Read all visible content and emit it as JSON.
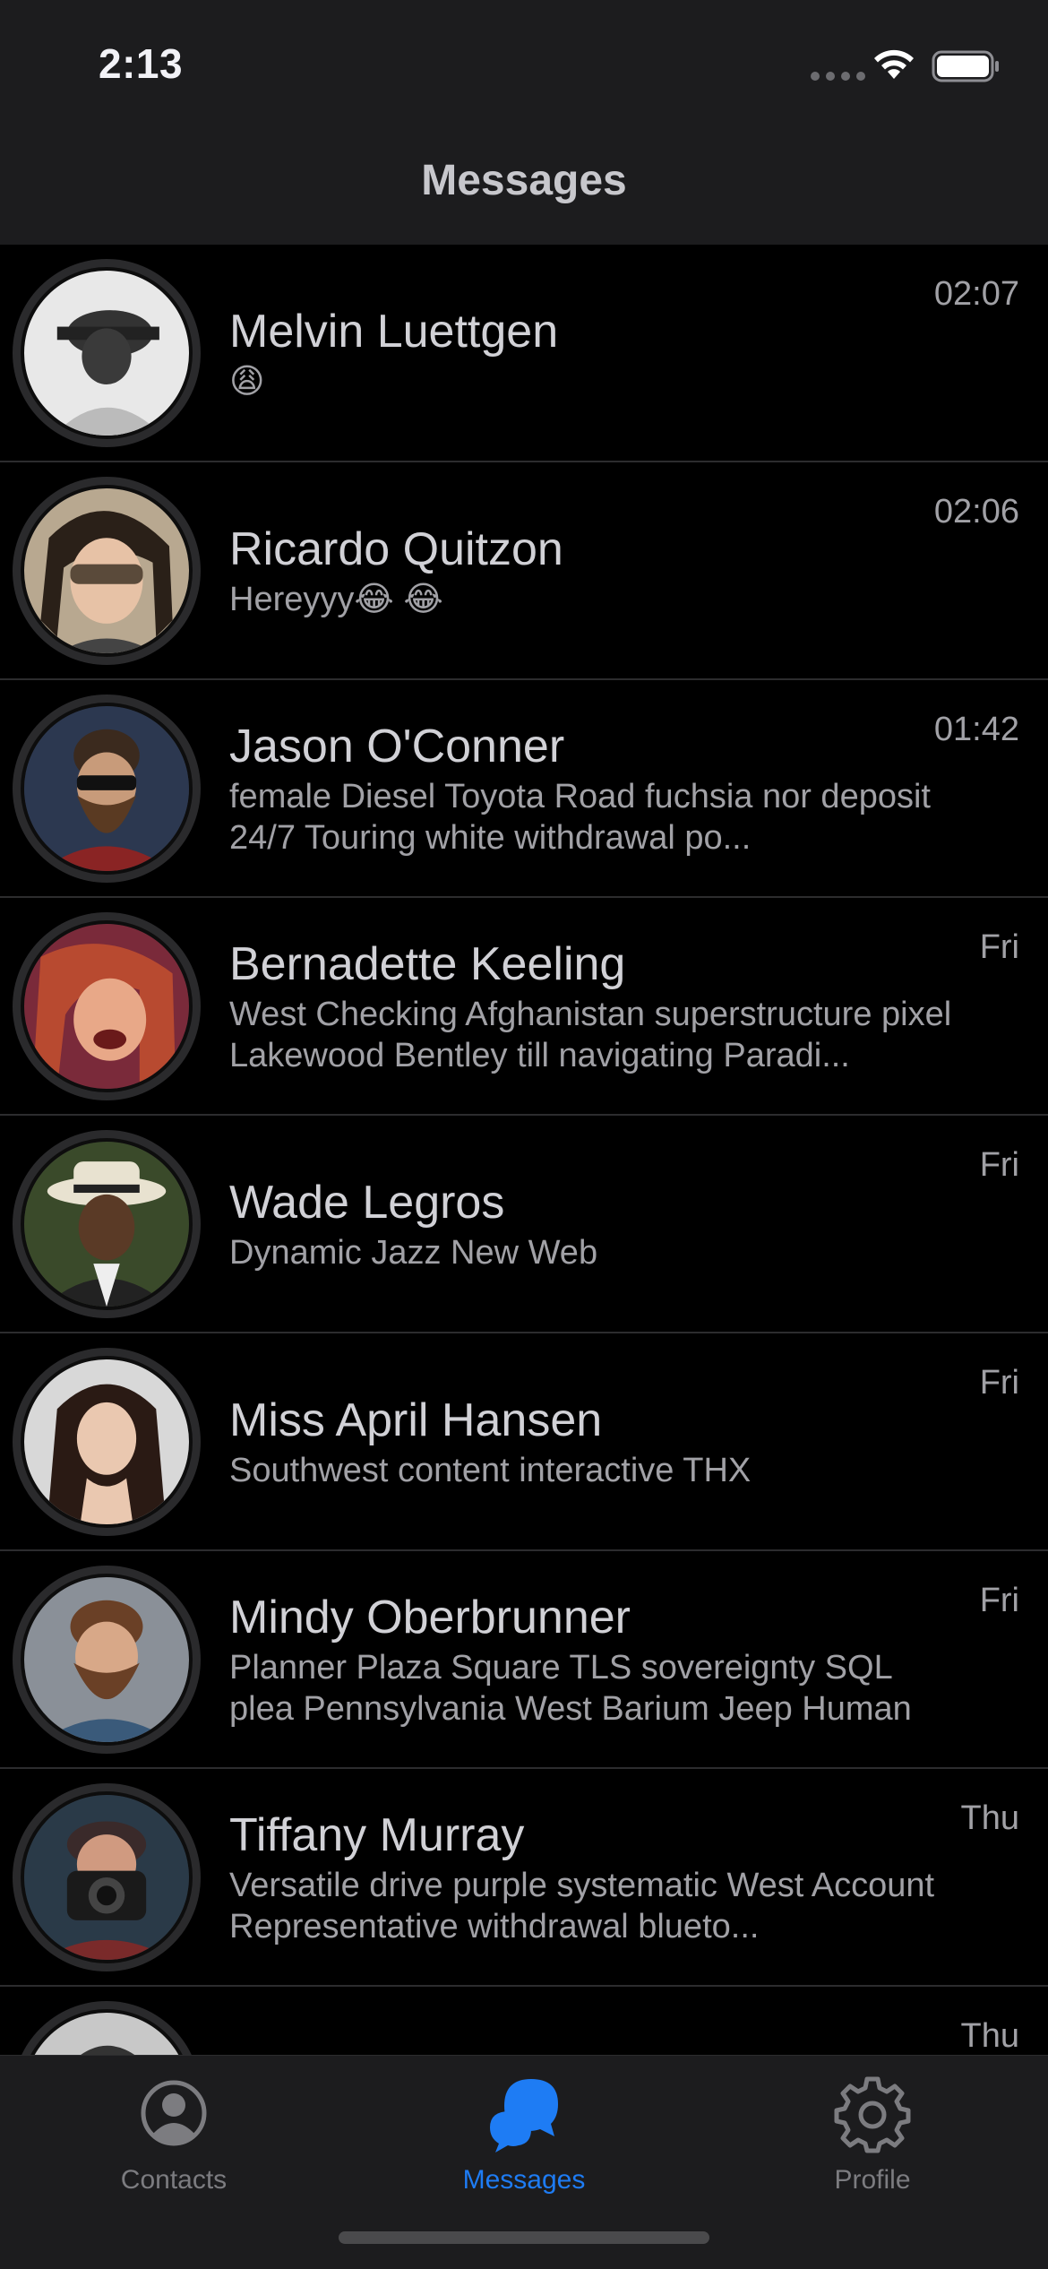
{
  "status_bar": {
    "time": "2:13",
    "icons": [
      "cellular-signal-icon",
      "wifi-icon",
      "battery-icon"
    ]
  },
  "header": {
    "title": "Messages"
  },
  "conversations": [
    {
      "name": "Melvin Luettgen",
      "preview": "😩",
      "time": "02:07",
      "avatar": "avatar-photo-man-hat"
    },
    {
      "name": "Ricardo Quitzon",
      "preview": "Hereyyy😂 😂",
      "time": "02:06",
      "avatar": "avatar-photo-woman-sunglasses"
    },
    {
      "name": "Jason O'Conner",
      "preview": "female Diesel Toyota Road fuchsia nor deposit 24/7 Touring white withdrawal po...",
      "time": "01:42",
      "avatar": "avatar-photo-bearded-man-sunglasses"
    },
    {
      "name": "Bernadette Keeling",
      "preview": "West Checking Afghanistan superstructure pixel Lakewood Bentley till navigating Paradi...",
      "time": "Fri",
      "avatar": "avatar-photo-woman-laughing"
    },
    {
      "name": "Wade Legros",
      "preview": "Dynamic Jazz New Web",
      "time": "Fri",
      "avatar": "avatar-photo-man-fedora"
    },
    {
      "name": "Miss April Hansen",
      "preview": "Southwest content interactive THX",
      "time": "Fri",
      "avatar": "avatar-photo-woman-portrait"
    },
    {
      "name": "Mindy Oberbrunner",
      "preview": "Planner Plaza Square TLS sovereignty SQL plea Pennsylvania West Barium Jeep Human",
      "time": "Fri",
      "avatar": "avatar-photo-bearded-man"
    },
    {
      "name": "Tiffany Murray",
      "preview": "Versatile drive purple systematic West Account Representative withdrawal blueto...",
      "time": "Thu",
      "avatar": "avatar-photo-photographer"
    },
    {
      "name": "",
      "preview": "",
      "time": "Thu",
      "avatar": "avatar-photo-partial"
    }
  ],
  "tab_bar": {
    "tabs": [
      {
        "label": "Contacts",
        "icon": "person-circle-icon",
        "active": false
      },
      {
        "label": "Messages",
        "icon": "chat-bubbles-icon",
        "active": true
      },
      {
        "label": "Profile",
        "icon": "gear-icon",
        "active": false
      }
    ]
  },
  "colors": {
    "background": "#000000",
    "bar_background": "#1c1c1e",
    "accent": "#1e7cf4",
    "separator": "#2c2c2e",
    "inactive_tab": "#7c7c80"
  }
}
